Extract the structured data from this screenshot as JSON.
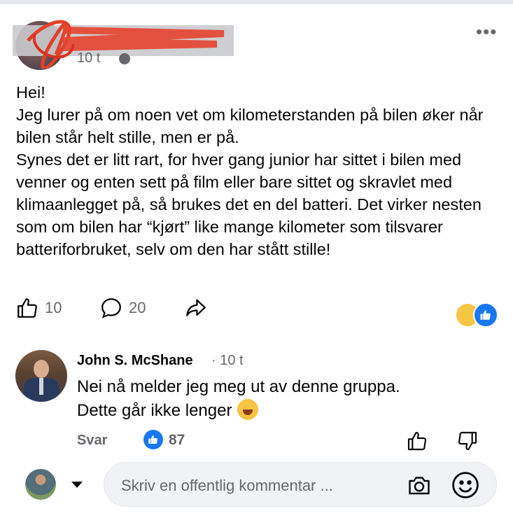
{
  "post": {
    "time": "10 t",
    "more_label": "•••",
    "text": "Hei!\nJeg lurer på om noen vet om kilometerstanden på bilen øker når bilen står helt stille, men er på.\nSynes det er litt rart, for hver gang junior har sittet i bilen med venner og enten sett på film eller bare sittet og skravlet med klimaanlegget på, så brukes det en del batteri. Det virker nesten som om bilen har “kjørt” like mange kilometer som tilsvarer batteriforbruket, selv om den har stått stille!",
    "like_count": "10",
    "comment_count": "20"
  },
  "comment": {
    "author": "John S. McShane",
    "time": "· 10 t",
    "text_line1": "Nei nå melder jeg meg ut av denne gruppa.",
    "text_line2": "Dette går ikke lenger",
    "reply_label": "Svar",
    "like_count": "87"
  },
  "composer": {
    "placeholder": "Skriv en offentlig kommentar ..."
  },
  "colors": {
    "accent": "#1877f2",
    "secondary_text": "#65676b"
  }
}
